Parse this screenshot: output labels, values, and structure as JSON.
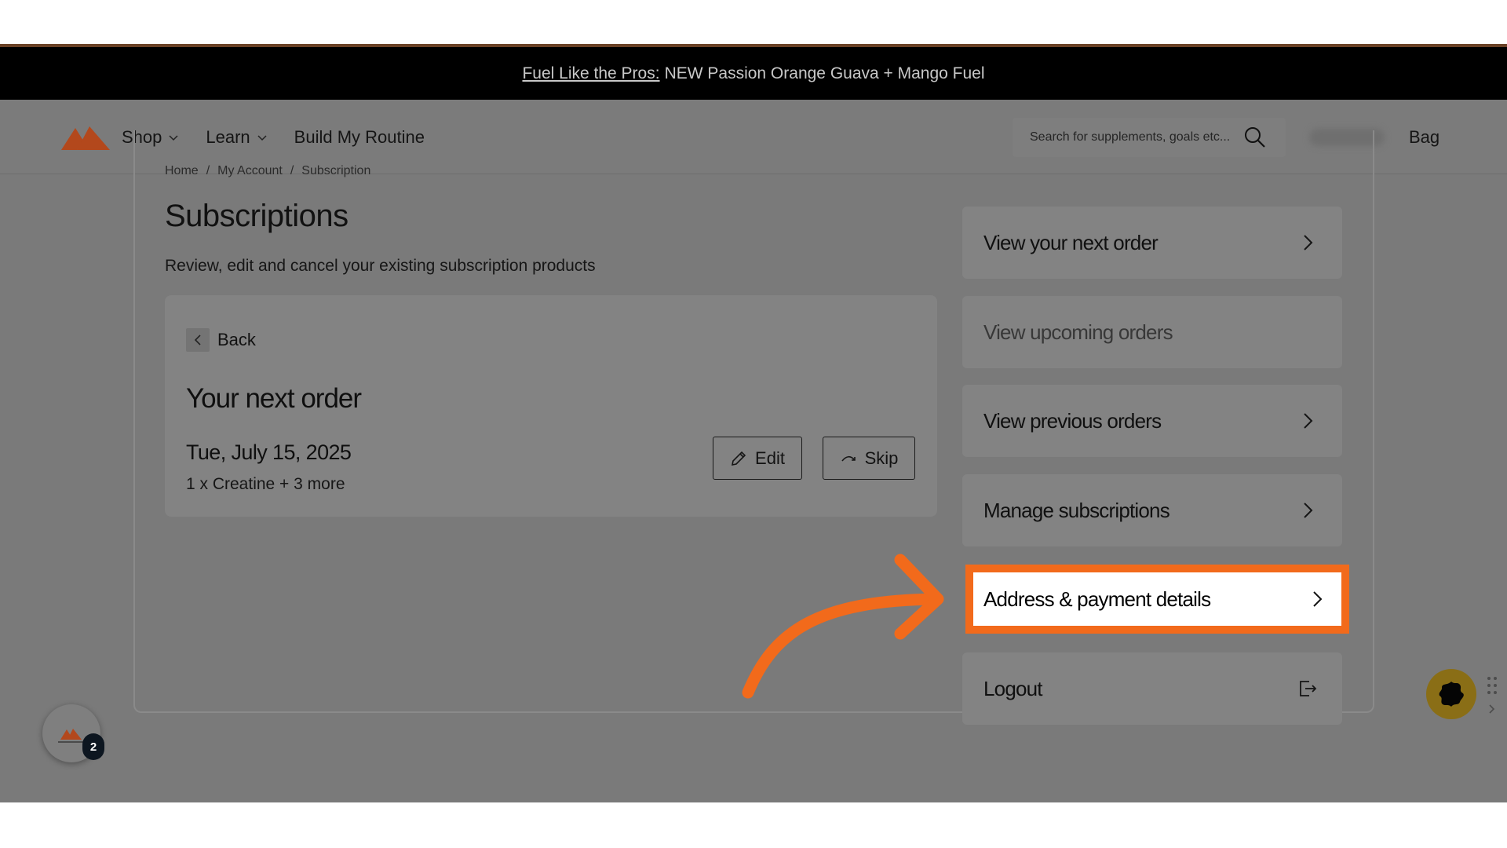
{
  "announcement": {
    "link_text": "Fuel Like the Pros:",
    "text": "NEW Passion Orange Guava + Mango Fuel"
  },
  "header": {
    "nav": [
      {
        "label": "Shop"
      },
      {
        "label": "Learn"
      },
      {
        "label": "Build My Routine"
      }
    ],
    "search_placeholder": "Search for supplements, goals etc...",
    "bag_label": "Bag"
  },
  "breadcrumb": [
    "Home",
    "My Account",
    "Subscription"
  ],
  "page": {
    "title": "Subscriptions",
    "description": "Review, edit and cancel your existing subscription products"
  },
  "order_card": {
    "back_label": "Back",
    "title": "Your next order",
    "date": "Tue, July 15, 2025",
    "items": "1 x Creatine + 3 more",
    "edit_label": "Edit",
    "skip_label": "Skip"
  },
  "sidebar": {
    "items": [
      {
        "label": "View your next order"
      },
      {
        "label": "View upcoming orders"
      },
      {
        "label": "View previous orders"
      },
      {
        "label": "Manage subscriptions"
      },
      {
        "label": "Address & payment details"
      },
      {
        "label": "Logout"
      }
    ]
  },
  "widgets": {
    "brand_badge_count": "2"
  },
  "colors": {
    "accent": "#f26a1b",
    "logo": "#b3481c",
    "banner": "#000000"
  }
}
